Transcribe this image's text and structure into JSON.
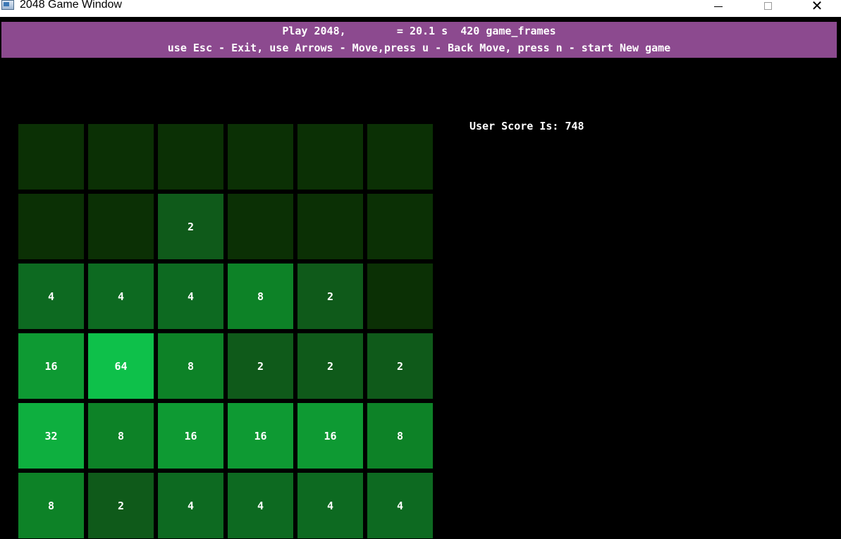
{
  "window": {
    "title": "2048 Game Window",
    "controls": {
      "minimize": "—",
      "maximize": "☐",
      "close": "✕"
    }
  },
  "header": {
    "line1": "Play 2048,        = 20.1 s  420 game_frames",
    "line2": "use Esc - Exit, use Arrows - Move,press u - Back Move, press n - start New game",
    "background": "#8c4a8f"
  },
  "score": {
    "label": "User Score Is: 748"
  },
  "board": {
    "rows": [
      [
        "",
        "",
        "",
        "",
        "",
        ""
      ],
      [
        "",
        "",
        "2",
        "",
        "",
        ""
      ],
      [
        "4",
        "4",
        "4",
        "8",
        "2",
        ""
      ],
      [
        "16",
        "64",
        "8",
        "2",
        "2",
        "2"
      ],
      [
        "32",
        "8",
        "16",
        "16",
        "16",
        "8"
      ],
      [
        "8",
        "2",
        "4",
        "4",
        "4",
        "4"
      ]
    ],
    "colors": [
      [
        "#0b3005",
        "#0b3005",
        "#0b3005",
        "#0b3005",
        "#0b3005",
        "#0b3005"
      ],
      [
        "#0b3005",
        "#0b3005",
        "#0f5a1a",
        "#0b3005",
        "#0b3005",
        "#0b3005"
      ],
      [
        "#0d6a21",
        "#0d6a21",
        "#0d6a21",
        "#0d8227",
        "#0f5a1a",
        "#0b3005"
      ],
      [
        "#0e9a33",
        "#0ec04a",
        "#0d8227",
        "#0f5a1a",
        "#0f5a1a",
        "#0f5a1a"
      ],
      [
        "#0eaf3f",
        "#0d8227",
        "#0e9a33",
        "#0e9a33",
        "#0e9a33",
        "#0d8227"
      ],
      [
        "#0d8227",
        "#0f5a1a",
        "#0d6a21",
        "#0d6a21",
        "#0d6a21",
        "#0d6a21"
      ]
    ]
  }
}
